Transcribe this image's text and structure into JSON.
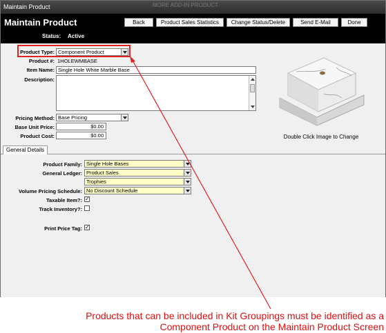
{
  "window": {
    "title": "Maintain Product",
    "ghost_title": "MORE ADD-IN PRODUCT"
  },
  "header": {
    "title": "Maintain Product",
    "status_label": "Status:",
    "status_value": "Active",
    "buttons": [
      "Back",
      "Product Sales Statistics",
      "Change Status/Delete",
      "Send E-Mail",
      "Done"
    ]
  },
  "form": {
    "product_type": {
      "label": "Product Type:",
      "value": "Component Product"
    },
    "product_number": {
      "label": "Product #:",
      "value": "1HOLEWMBASE"
    },
    "item_name": {
      "label": "Item Name:",
      "value": "Single Hole White Marble Base"
    },
    "description": {
      "label": "Description:",
      "value": ""
    },
    "pricing_method": {
      "label": "Pricing Method:",
      "value": "Base Pricing"
    },
    "base_unit_price": {
      "label": "Base Unit Price:",
      "value": "$0.00"
    },
    "product_cost": {
      "label": "Product Cost:",
      "value": "$0.00"
    }
  },
  "image": {
    "caption": "Double Click Image to Change",
    "icon": "marble-base-image"
  },
  "tabs": [
    {
      "label": "General Details"
    }
  ],
  "general": {
    "product_family": {
      "label": "Product Family:",
      "value": "Single Hole Bases"
    },
    "general_ledger": {
      "label": "General Ledger:",
      "value": "Product Sales"
    },
    "ledger_secondary": {
      "value": "Trophies"
    },
    "volume_pricing": {
      "label": "Volume Pricing Schedule:",
      "value": "No Discount Schedule"
    },
    "taxable": {
      "label": "Taxable Item?:",
      "checked": true
    },
    "track_inventory": {
      "label": "Track Inventory?:",
      "checked": false
    },
    "print_price_tag": {
      "label": "Print Price Tag:",
      "checked": true
    }
  },
  "annotation": {
    "line1": "Products that can be included in Kit Groupings must be identified as a",
    "line2": "Component Product on the Maintain Product Screen",
    "color": "#e01010"
  },
  "colors": {
    "header_bg": "#000000",
    "highlight_field": "#ffffc8",
    "callout_red": "#e02020"
  }
}
